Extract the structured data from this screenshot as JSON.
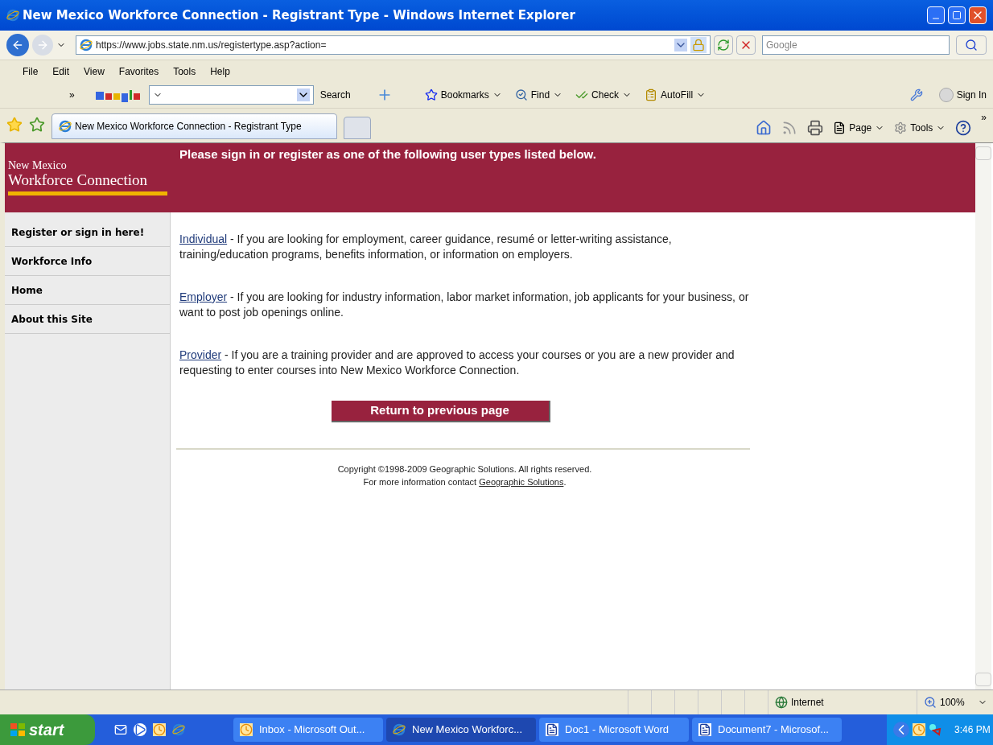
{
  "window": {
    "title": "New Mexico Workforce Connection - Registrant Type - Windows Internet Explorer"
  },
  "address": {
    "url": "https://www.jobs.state.nm.us/registertype.asp?action=",
    "search_placeholder": "Google"
  },
  "menu": [
    "File",
    "Edit",
    "View",
    "Favorites",
    "Tools",
    "Help"
  ],
  "google_toolbar": {
    "more": "»",
    "search": "Search",
    "items": [
      {
        "kind": "bookmarks",
        "label": "Bookmarks"
      },
      {
        "kind": "find",
        "label": "Find"
      },
      {
        "kind": "check",
        "label": "Check"
      },
      {
        "kind": "autofill",
        "label": "AutoFill"
      }
    ],
    "sign_in": "Sign In"
  },
  "tabs": [
    {
      "label": "New Mexico Workforce Connection - Registrant Type",
      "selected": true
    }
  ],
  "command_bar": {
    "page": "Page",
    "tools": "Tools",
    "more": "»"
  },
  "page": {
    "logo": {
      "line1": "New Mexico",
      "line2": "Workforce Connection"
    },
    "header": "Please sign in or register as one of the following user types listed below.",
    "sidebar": [
      {
        "label": "Register or sign in here!"
      },
      {
        "label": "Workforce Info"
      },
      {
        "label": "Home"
      },
      {
        "label": "About this Site"
      }
    ],
    "options": [
      {
        "link": "Individual",
        "text": " - If you are looking for employment, career guidance, resumé or letter-writing assistance, training/education programs, benefits information, or information on employers."
      },
      {
        "link": "Employer",
        "text": " - If you are looking for industry information, labor market information, job applicants for your business, or want to post job openings online."
      },
      {
        "link": "Provider",
        "text": " - If you are a training provider and are approved to access your courses or you are a new provider and requesting to enter courses into New Mexico Workforce Connection."
      }
    ],
    "button": "Return to previous page",
    "copyright": "Copyright ©1998-2009 Geographic Solutions. All rights reserved.",
    "contact": {
      "text": "For more information contact ",
      "link": "Geographic Solutions",
      "end": "."
    }
  },
  "status_bar": {
    "zone": "Internet",
    "zoom": "100%"
  },
  "taskbar": {
    "start": "start",
    "tasks": [
      {
        "kind": "outlook",
        "label": "Inbox - Microsoft Out...",
        "selected": false
      },
      {
        "kind": "ie",
        "label": "New Mexico Workforc...",
        "selected": true
      },
      {
        "kind": "word",
        "label": "Doc1 - Microsoft Word",
        "selected": false
      },
      {
        "kind": "word",
        "label": "Document7 - Microsof...",
        "selected": false
      }
    ],
    "clock": "3:46 PM"
  }
}
